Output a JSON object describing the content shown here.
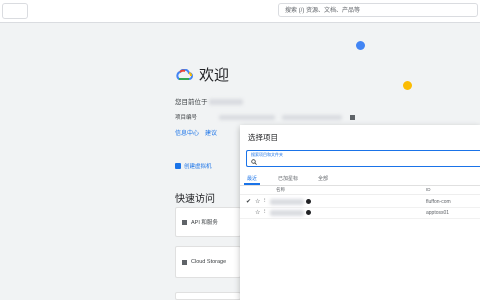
{
  "header": {
    "search_placeholder": "搜索 (/) 资源、文档、产品等"
  },
  "welcome": {
    "title": "欢迎",
    "working_in_label": "您目前位于",
    "project_number_label": "项目编号"
  },
  "links": {
    "dashboard": "信息中心",
    "recommendations": "建议"
  },
  "actions": {
    "create_vm": "创建虚拟机"
  },
  "quick_access": {
    "title": "快速访问",
    "items": [
      {
        "label": "API 和服务"
      },
      {
        "label": "Cloud Storage"
      }
    ]
  },
  "dialog": {
    "title": "选择项目",
    "search_label": "搜索项目和文件夹",
    "tabs": [
      "最近",
      "已加星标",
      "全部"
    ],
    "active_tab": "最近",
    "columns": {
      "name": "名称",
      "id": "ID"
    },
    "rows": [
      {
        "checked": true,
        "id": "fluffon-com"
      },
      {
        "checked": false,
        "id": "apptoss01"
      }
    ]
  },
  "colors": {
    "accent": "#1a73e8",
    "dot_blue": "#4285f4",
    "dot_yellow": "#fbbc04"
  }
}
